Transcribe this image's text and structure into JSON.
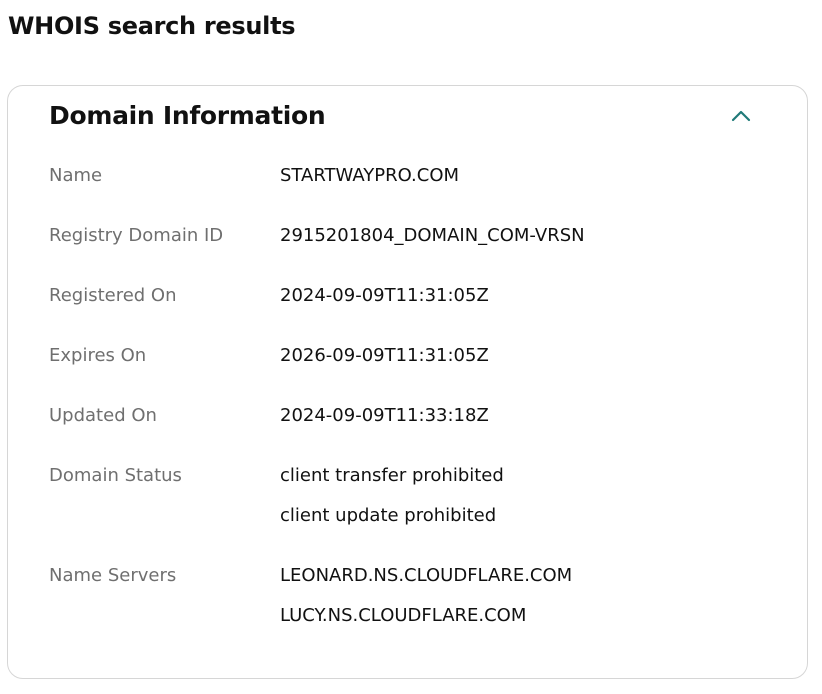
{
  "page": {
    "title": "WHOIS search results"
  },
  "domain_info": {
    "section_title": "Domain Information",
    "toggle_icon": "chevron-up-icon",
    "accent_color": "#1f7a78",
    "rows": [
      {
        "label": "Name",
        "values": [
          "STARTWAYPRO.COM"
        ]
      },
      {
        "label": "Registry Domain ID",
        "values": [
          "2915201804_DOMAIN_COM-VRSN"
        ]
      },
      {
        "label": "Registered On",
        "values": [
          "2024-09-09T11:31:05Z"
        ]
      },
      {
        "label": "Expires On",
        "values": [
          "2026-09-09T11:31:05Z"
        ]
      },
      {
        "label": "Updated On",
        "values": [
          "2024-09-09T11:33:18Z"
        ]
      },
      {
        "label": "Domain Status",
        "values": [
          "client transfer prohibited",
          "client update prohibited"
        ]
      },
      {
        "label": "Name Servers",
        "values": [
          "LEONARD.NS.CLOUDFLARE.COM",
          "LUCY.NS.CLOUDFLARE.COM"
        ]
      }
    ]
  }
}
